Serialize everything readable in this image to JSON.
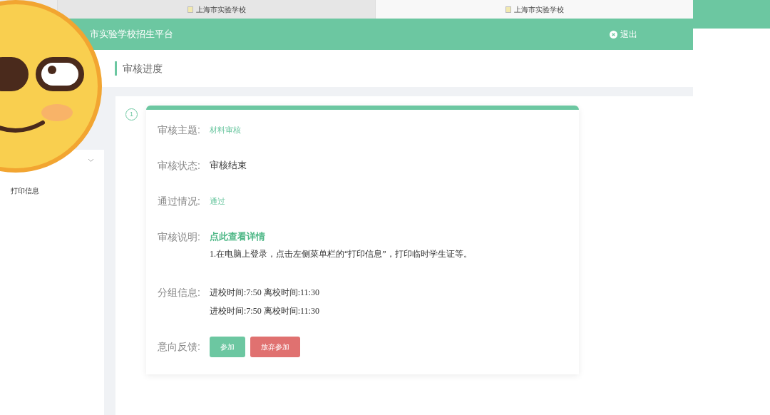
{
  "browser_tabs": [
    {
      "title": "上海市实验学校",
      "selected": false
    },
    {
      "title": "上海市实验学校",
      "selected": true
    }
  ],
  "header": {
    "title": "市实验学校招生平台",
    "logout": "退出"
  },
  "sidebar": {
    "items": [
      {
        "label": "打印信息"
      }
    ]
  },
  "section_title": "审核进度",
  "step": {
    "number": "1"
  },
  "review": {
    "rows": [
      {
        "kind": "accent",
        "label": "审核主题:",
        "value": "材料审核"
      },
      {
        "kind": "text",
        "label": "审核状态:",
        "value": "审核结束"
      },
      {
        "kind": "accent",
        "label": "通过情况:",
        "value": "通过"
      },
      {
        "kind": "link",
        "label": "审核说明:",
        "value": "点此查看详情",
        "note": "1.在电脑上登录，点击左侧菜单栏的“打印信息”，打印临时学生证等。"
      },
      {
        "kind": "lines",
        "label": "分组信息:",
        "lines": [
          "进校时间:7:50 离校时间:11:30",
          "进校时间:7:50 离校时间:11:30"
        ]
      },
      {
        "kind": "buttons",
        "label": "意向反馈:",
        "buttons": [
          {
            "label": "参加",
            "kind": "confirm"
          },
          {
            "label": "放弃参加",
            "kind": "decline"
          }
        ]
      }
    ]
  }
}
